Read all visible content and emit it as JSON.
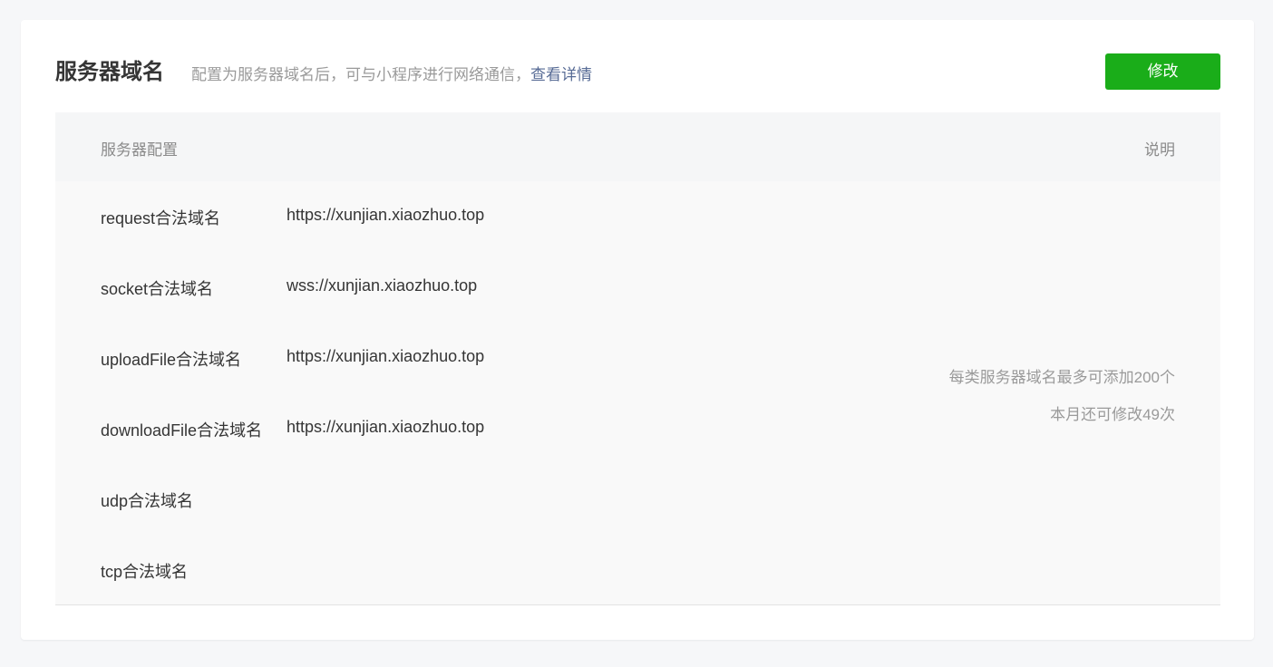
{
  "header": {
    "title": "服务器域名",
    "description": "配置为服务器域名后，可与小程序进行网络通信，",
    "details_link": "查看详情",
    "edit_button": "修改"
  },
  "table": {
    "columns": [
      "服务器配置",
      "说明"
    ],
    "rows": [
      {
        "label": "request合法域名",
        "value": "https://xunjian.xiaozhuo.top"
      },
      {
        "label": "socket合法域名",
        "value": "wss://xunjian.xiaozhuo.top"
      },
      {
        "label": "uploadFile合法域名",
        "value": "https://xunjian.xiaozhuo.top"
      },
      {
        "label": "downloadFile合法域名",
        "value": "https://xunjian.xiaozhuo.top"
      },
      {
        "label": "udp合法域名",
        "value": ""
      },
      {
        "label": "tcp合法域名",
        "value": ""
      }
    ],
    "notes": [
      "每类服务器域名最多可添加200个",
      "本月还可修改49次"
    ]
  },
  "colors": {
    "accent_green": "#1aad19",
    "link_blue": "#576b95"
  }
}
